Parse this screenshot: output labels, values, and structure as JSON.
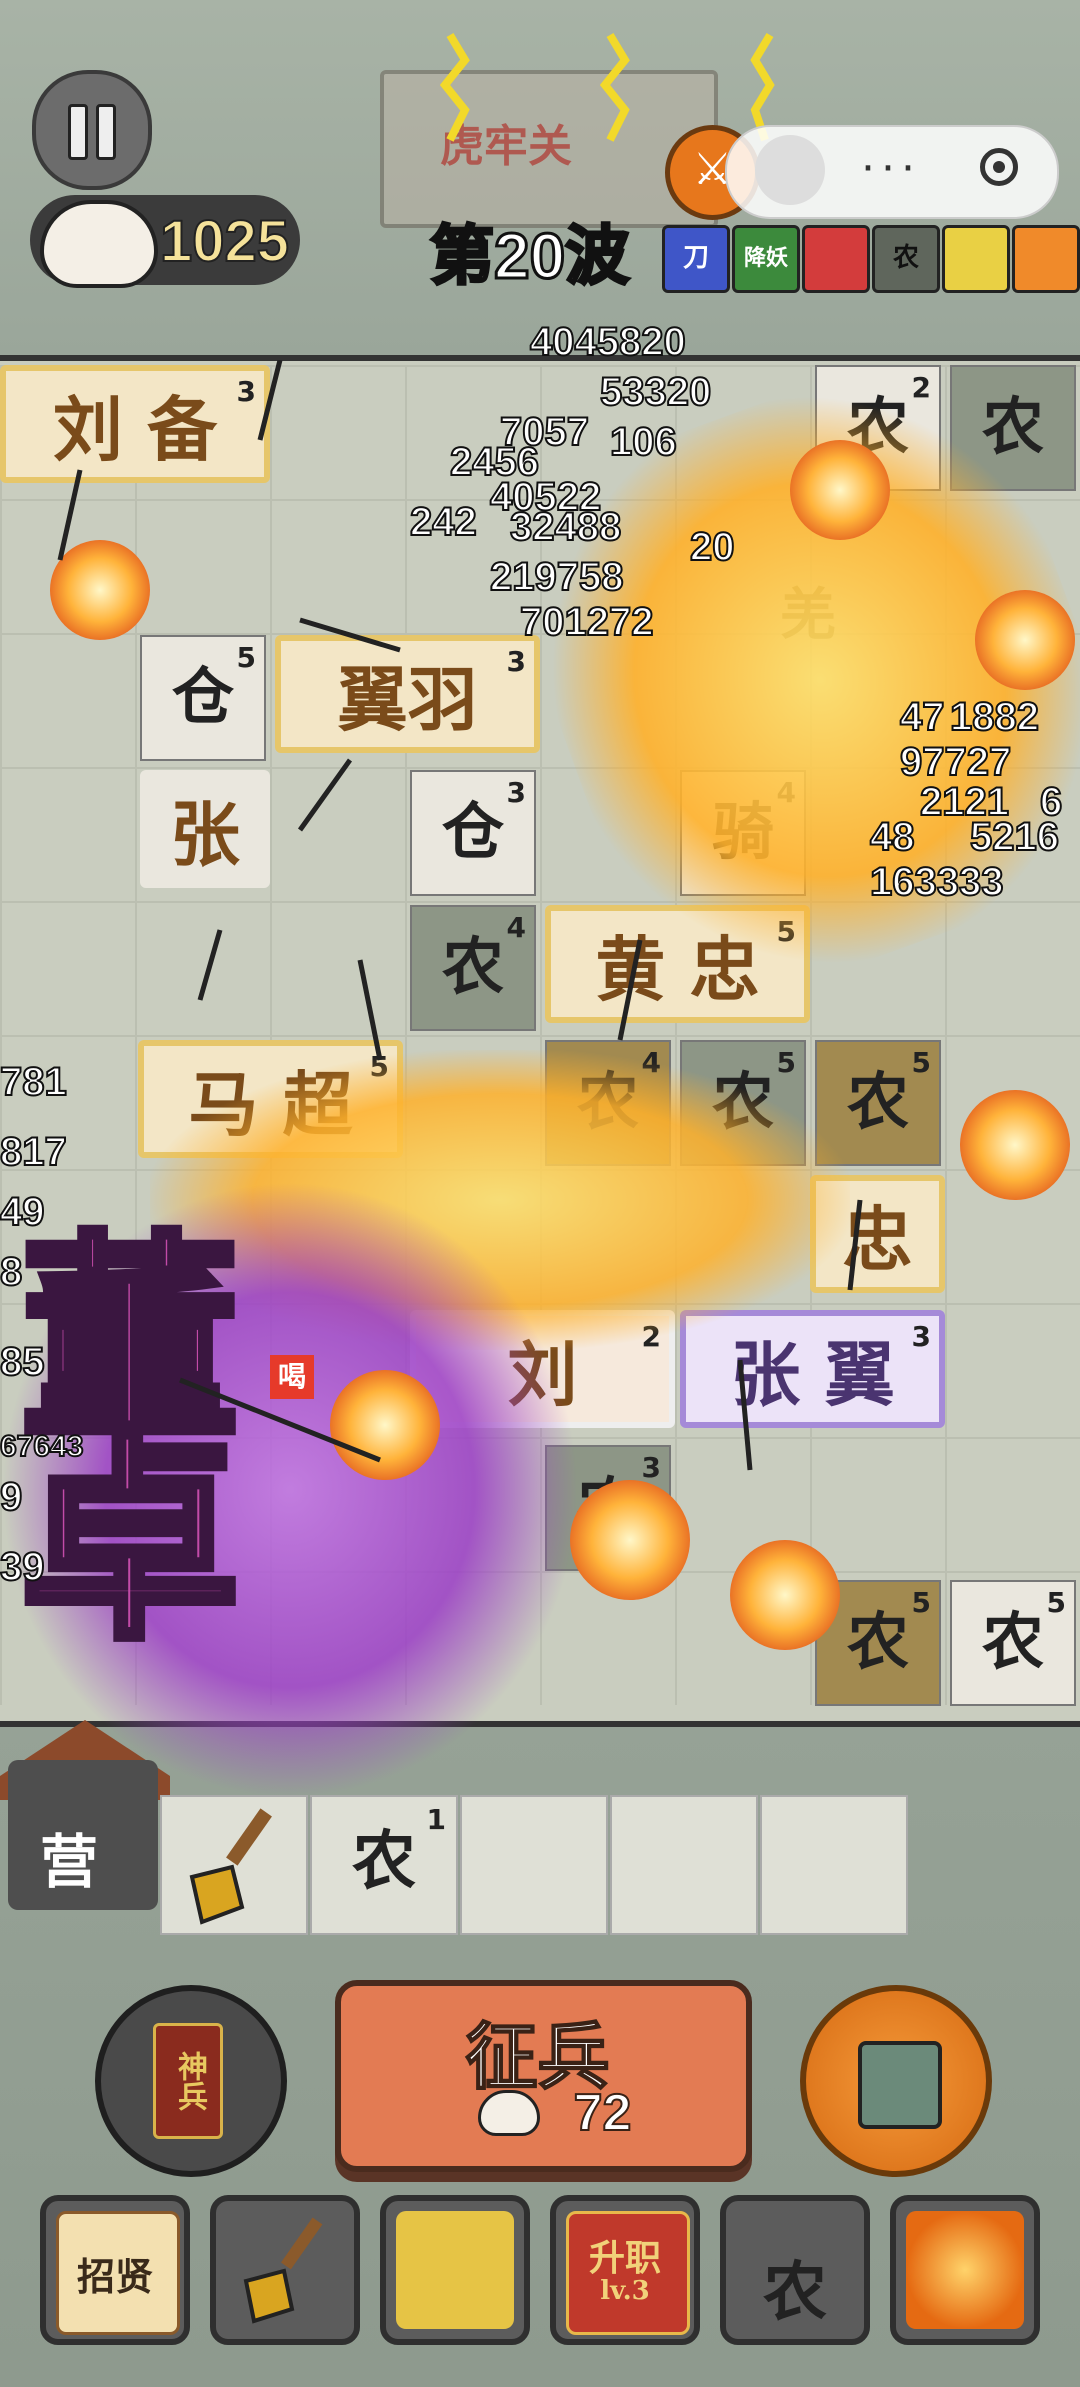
{
  "hud": {
    "pass_name": "虎牢关",
    "coins": "1025",
    "wave": "第20波",
    "menu_dots": "···",
    "skills": [
      "刀",
      "降妖",
      "",
      "农",
      "",
      ""
    ]
  },
  "board": {
    "heroes": [
      {
        "name": "刘  备",
        "level": "3"
      },
      {
        "name": "翼羽",
        "level": "3"
      },
      {
        "name": "张",
        "level": ""
      },
      {
        "name": "黄  忠",
        "level": "5"
      },
      {
        "name": "马  超",
        "level": "5"
      },
      {
        "name": "忠",
        "level": ""
      },
      {
        "name": "张  翼",
        "level": "3"
      },
      {
        "name": "刘",
        "level": "2"
      }
    ],
    "units": [
      {
        "label": "农",
        "level": "2"
      },
      {
        "label": "农",
        "level": ""
      },
      {
        "label": "仓",
        "level": "5"
      },
      {
        "label": "仓",
        "level": "3"
      },
      {
        "label": "骑",
        "level": "4"
      },
      {
        "label": "农",
        "level": "4"
      },
      {
        "label": "农",
        "level": "4"
      },
      {
        "label": "农",
        "level": "5"
      },
      {
        "label": "农",
        "level": "5"
      },
      {
        "label": "农",
        "level": "3"
      },
      {
        "label": "农",
        "level": "5"
      },
      {
        "label": "农",
        "level": "5"
      },
      {
        "label": "羌",
        "level": ""
      }
    ],
    "damage_numbers": [
      "4045820",
      "53320",
      "7057",
      "106",
      "2456",
      "40522",
      "242",
      "32488",
      "20",
      "219758",
      "701272",
      "47",
      "1882",
      "97727",
      "6",
      "2121",
      "48",
      "5216",
      "163333",
      "781",
      "817",
      "49",
      "8",
      "85",
      "67643",
      "9",
      "39"
    ],
    "enemy_title": "董卓",
    "tag": "喝"
  },
  "bottom": {
    "camp_label": "营",
    "slot_unit": {
      "label": "农",
      "level": "1"
    },
    "left_round_label": "神兵",
    "recruit_label": "征兵",
    "recruit_cost": "72",
    "toolbar": [
      {
        "label": "招贤"
      },
      {
        "label": ""
      },
      {
        "label": ""
      },
      {
        "label": "升职",
        "sub": "lv.3"
      },
      {
        "label": "农"
      },
      {
        "label": ""
      }
    ]
  },
  "colors": {
    "gold_tile": "#e6c66a",
    "purple_tile": "#a58ad8",
    "recruit": "#e37b53",
    "fire": "#ffb33a"
  }
}
